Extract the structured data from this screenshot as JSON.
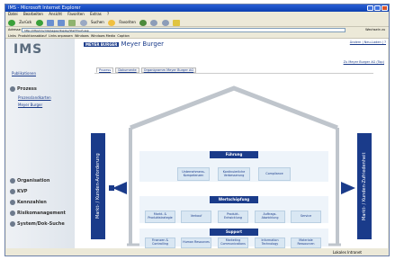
{
  "window": {
    "title": "IMS - Microsoft Internet Explorer",
    "menu": [
      "Datei",
      "Bearbeiten",
      "Ansicht",
      "Favoriten",
      "Extras",
      "?"
    ],
    "toolbar": {
      "back": "Zurück",
      "search": "Suchen",
      "favorites": "Favoriten"
    },
    "address_label": "Adresse",
    "address": "http://http/ims/mb/pages/display/Startfrauh.asp",
    "go_label": "Wechseln zu",
    "links": [
      "Links",
      "Produktionsablauf",
      "Links anpassen",
      "Windows",
      "Windows Media",
      "Caption"
    ],
    "status": "Lokales Intranet"
  },
  "sidebar": {
    "logo": "IMS",
    "publikationen": "Publikationen",
    "process": "Prozess",
    "prozess_links": [
      "Prozesslandkarten",
      "Meyer Burger"
    ],
    "nav": [
      "Organisation",
      "KVP",
      "Kennzahlen",
      "Risikomanagement",
      "System/Dok-Suche"
    ]
  },
  "header": {
    "brand_tag": "MEYER BURGER",
    "brand_name": "Meyer Burger",
    "top_links": "Ändern | Neu-Laden | ?",
    "sub_link": "Zu Meyer Burger AG (Top)"
  },
  "tabs": [
    "Prozess",
    "Dokumente",
    "Organigramm Meyer Burger AG"
  ],
  "diagram": {
    "left_arrow": "Markt- / Kunden-Anforderung",
    "right_arrow": "Markt- / Kunden-Zufriedenheit",
    "sections": {
      "fuehrung": {
        "title": "Führung",
        "boxes": [
          "Unternehmens-Kompetenzen",
          "Kontinuierliche Verbesserung",
          "Compliance"
        ]
      },
      "wertschoepfung": {
        "title": "Wertschöpfung",
        "boxes": [
          "Markt- & Produktstrategie",
          "Verkauf",
          "Produkt-Entwicklung",
          "Auftrags-Abwicklung",
          "Service"
        ]
      },
      "support": {
        "title": "Support",
        "boxes": [
          "Finanzen & Controlling",
          "Human Resources",
          "Marketing Communications",
          "Information Technology",
          "Materiale Ressourcen"
        ]
      }
    }
  },
  "colors": {
    "navy": "#1a3b8a",
    "box": "#d9e7f3",
    "titlebar": "#0b3fb0"
  }
}
